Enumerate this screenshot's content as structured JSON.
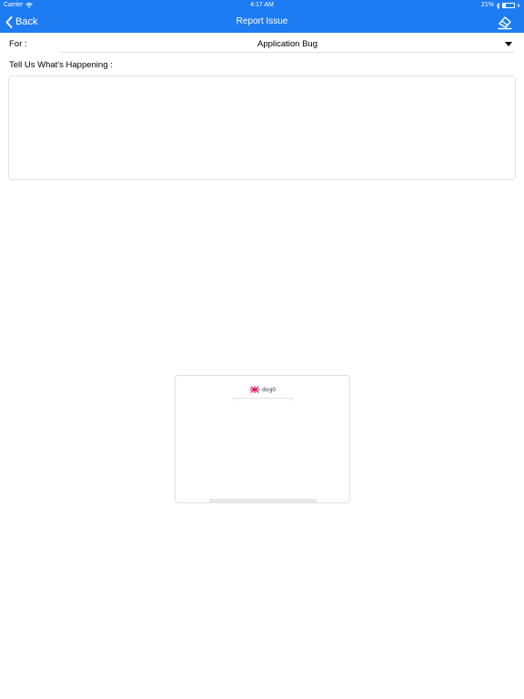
{
  "status_bar": {
    "carrier": "Carrier",
    "time": "4:17 AM",
    "battery_percent": "21%",
    "battery_level": 0.21,
    "icons": [
      "wifi-icon",
      "bluetooth-icon",
      "battery-icon"
    ]
  },
  "nav": {
    "back_label": "Back",
    "title": "Report Issue",
    "submit_icon": "eraser-icon",
    "background_color": "#1e7cf2"
  },
  "form": {
    "for_label": "For :",
    "for_value": "Application Bug",
    "happening_label": "Tell Us What's Happening :",
    "description_value": ""
  },
  "loading_card": {
    "logo_text": "dog0"
  }
}
